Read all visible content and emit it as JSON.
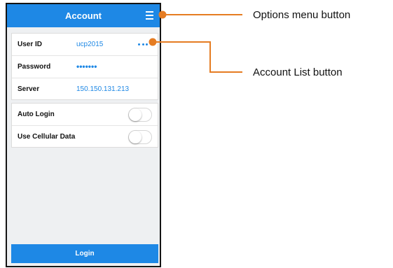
{
  "screen": {
    "title": "Account",
    "fields": [
      {
        "label": "User ID",
        "value": "ucp2015"
      },
      {
        "label": "Password",
        "value": "•••••••"
      },
      {
        "label": "Server",
        "value": "150.150.131.213"
      }
    ],
    "toggles": [
      {
        "label": "Auto Login",
        "state": "off"
      },
      {
        "label": "Use Cellular Data",
        "state": "off"
      }
    ],
    "login_label": "Login"
  },
  "callouts": {
    "options_menu": "Options menu button",
    "account_list": "Account List button"
  },
  "colors": {
    "accent": "#1e88e5",
    "callout_line": "#e57c22"
  },
  "icons": {
    "options": "hamburger-menu-icon",
    "account_list": "more-dots-icon"
  }
}
